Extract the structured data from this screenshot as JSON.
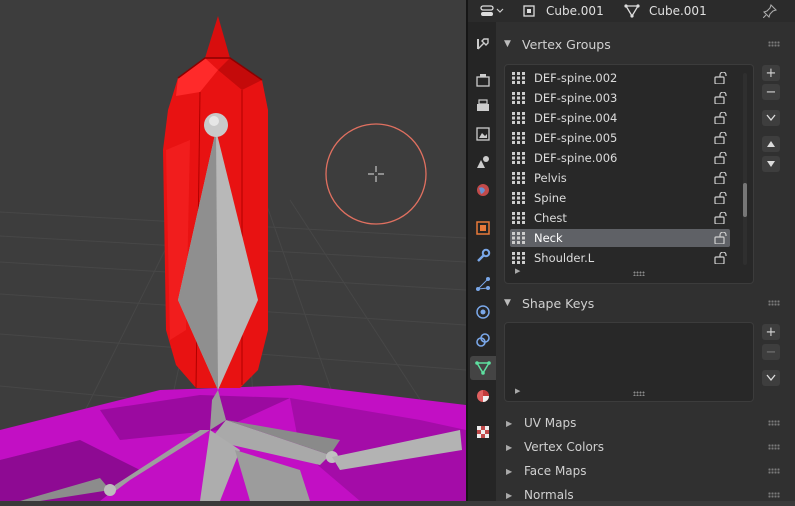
{
  "header": {
    "object_name": "Cube.001",
    "mesh_name": "Cube.001"
  },
  "vertex_groups": {
    "title": "Vertex Groups",
    "items": [
      {
        "name": "DEF-spine.002",
        "selected": false
      },
      {
        "name": "DEF-spine.003",
        "selected": false
      },
      {
        "name": "DEF-spine.004",
        "selected": false
      },
      {
        "name": "DEF-spine.005",
        "selected": false
      },
      {
        "name": "DEF-spine.006",
        "selected": false
      },
      {
        "name": "Pelvis",
        "selected": false
      },
      {
        "name": "Spine",
        "selected": false
      },
      {
        "name": "Chest",
        "selected": false
      },
      {
        "name": "Neck",
        "selected": true
      },
      {
        "name": "Shoulder.L",
        "selected": false
      }
    ]
  },
  "shape_keys": {
    "title": "Shape Keys"
  },
  "collapsed_panels": [
    "UV Maps",
    "Vertex Colors",
    "Face Maps",
    "Normals"
  ],
  "colors": {
    "mesh_red": "#e81010",
    "ground_magenta": "#c20fc4",
    "bone_gray": "#a9a9a9",
    "selection_row": "#5f6166",
    "brush_circle": "#e07060"
  }
}
